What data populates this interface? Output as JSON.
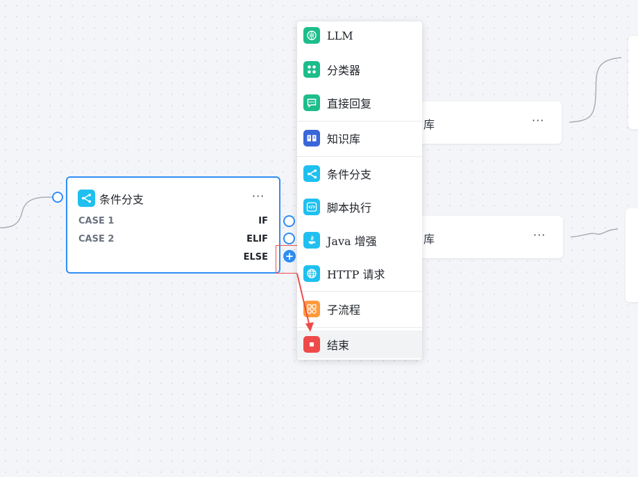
{
  "background_nodes": [
    {
      "title": "库",
      "more": "···"
    },
    {
      "title": "库",
      "more": "···"
    }
  ],
  "condition_node": {
    "title": "条件分支",
    "more": "···",
    "cases": [
      {
        "label": "CASE 1",
        "branch": "IF"
      },
      {
        "label": "CASE 2",
        "branch": "ELIF"
      }
    ],
    "else_label": "ELSE",
    "add_symbol": "+"
  },
  "menu": {
    "items": [
      {
        "label": "LLM",
        "icon": "brain-icon",
        "color": "#1dbd8a"
      },
      {
        "label": "分类器",
        "icon": "classifier-icon",
        "color": "#1dbd8a"
      },
      {
        "label": "直接回复",
        "icon": "reply-icon",
        "color": "#1dbd8a"
      },
      {
        "label": "知识库",
        "icon": "book-icon",
        "color": "#3a66d9"
      },
      {
        "label": "条件分支",
        "icon": "branch-icon",
        "color": "#1fc0ef"
      },
      {
        "label": "脚本执行",
        "icon": "code-icon",
        "color": "#1fc0ef"
      },
      {
        "label": "Java 增强",
        "icon": "java-icon",
        "color": "#1fc0ef"
      },
      {
        "label": "HTTP 请求",
        "icon": "globe-icon",
        "color": "#1fc0ef"
      },
      {
        "label": "子流程",
        "icon": "subflow-icon",
        "color": "#ff9a3c"
      },
      {
        "label": "结束",
        "icon": "stop-icon",
        "color": "#ef4a4a"
      }
    ]
  },
  "colors": {
    "accent": "#2e8df5",
    "highlight": "#ef4a4a"
  }
}
